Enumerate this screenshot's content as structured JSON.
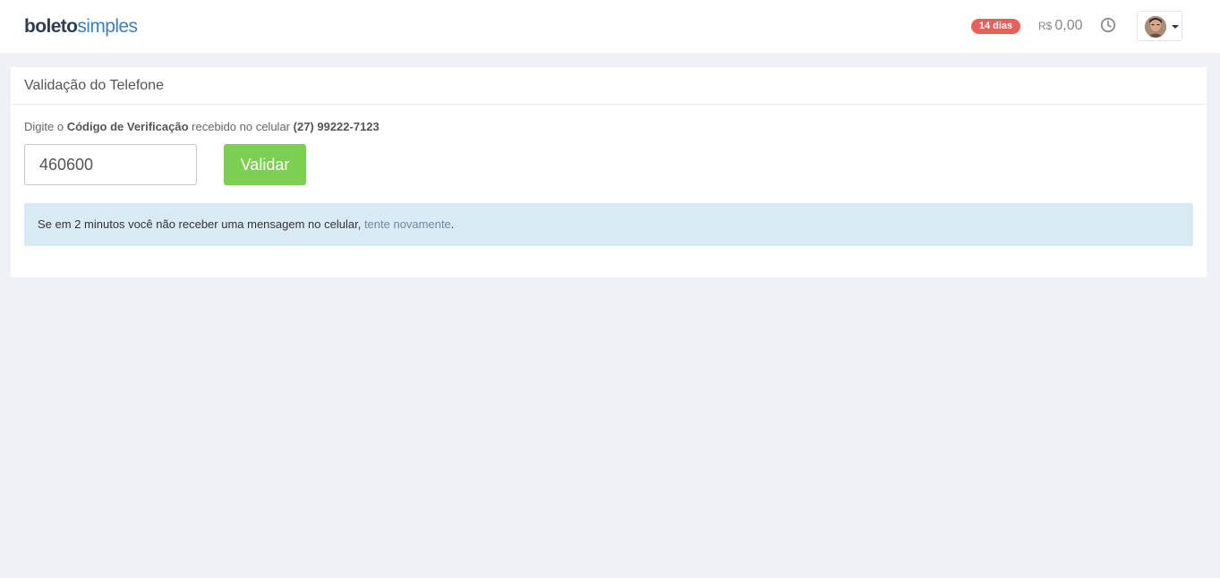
{
  "brand": {
    "part1": "boleto",
    "part2": "simples"
  },
  "header": {
    "trial_badge": "14 dias",
    "balance_currency": "R$",
    "balance_value": "0,00",
    "history_icon": "clock-icon",
    "avatar_icon": "user-avatar"
  },
  "panel": {
    "title": "Validação do Telefone",
    "instruction": {
      "prefix": "Digite o",
      "code_label": "Código de Verificação",
      "middle": "recebido no celular",
      "phone": "(27) 99222-7123"
    },
    "code_value": "460600",
    "validate_label": "Validar",
    "alert": {
      "text": "Se em 2 minutos você não receber uma mensagem no celular,",
      "retry_link": "tente novamente",
      "end": "."
    }
  },
  "colors": {
    "badge": "#e8605a",
    "button": "#7ccf50",
    "alert_bg": "#d9eaf4",
    "link": "#6f8ba0",
    "page_bg": "#eff1f6"
  }
}
